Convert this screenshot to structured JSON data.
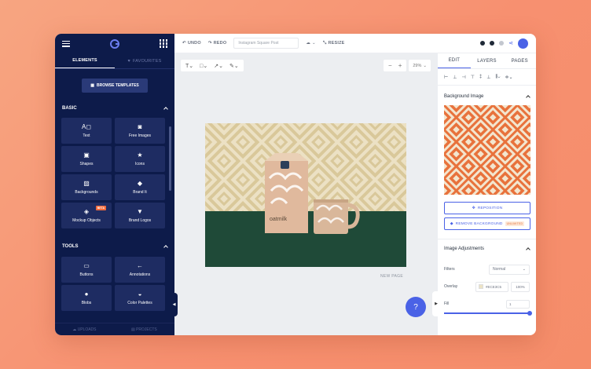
{
  "sidebar": {
    "tabs": {
      "elements": "ELEMENTS",
      "favourites": "FAVOURITES"
    },
    "browse_templates": "BROWSE TEMPLATES",
    "basic_title": "BASIC",
    "basic_items": [
      {
        "label": "Text",
        "icon": "text-icon"
      },
      {
        "label": "Free Images",
        "icon": "camera-icon"
      },
      {
        "label": "Shapes",
        "icon": "shapes-icon"
      },
      {
        "label": "Icons",
        "icon": "star-icon"
      },
      {
        "label": "Backgrounds",
        "icon": "pattern-icon"
      },
      {
        "label": "Brand It",
        "icon": "tag-icon"
      },
      {
        "label": "Mockup Objects",
        "icon": "cube-icon",
        "badge": "BETA"
      },
      {
        "label": "Brand Logos",
        "icon": "diamond-icon"
      }
    ],
    "tools_title": "TOOLS",
    "tools_items": [
      {
        "label": "Buttons",
        "icon": "cursor-icon"
      },
      {
        "label": "Annotations",
        "icon": "arrow-icon"
      },
      {
        "label": "Blobs",
        "icon": "blob-icon"
      },
      {
        "label": "Color Palettes",
        "icon": "palette-icon"
      }
    ],
    "bottom": {
      "uploads": "UPLOADS",
      "projects": "PROJECTS"
    }
  },
  "topbar": {
    "undo": "UNDO",
    "redo": "REDO",
    "doc_name_placeholder": "Instagram Square Post",
    "resize": "RESIZE"
  },
  "canvas": {
    "zoom": "29%",
    "new_page": "NEW PAGE",
    "help": "?",
    "product_label": "oatmilk"
  },
  "right_panel": {
    "tabs": [
      "EDIT",
      "LAYERS",
      "PAGES"
    ],
    "background_image_title": "Background Image",
    "reposition": "REPOSITION",
    "remove_background": "REMOVE BACKGROUND",
    "unlimited_badge": "UNLIMITED",
    "image_adjustments_title": "Image Adjustments",
    "filters_label": "Filters",
    "filters_value": "Normal",
    "overlay_label": "Overlay",
    "overlay_color": "#ECE3C5",
    "overlay_opacity": "100%",
    "fill_label": "Fill",
    "fill_value": "1"
  },
  "colors": {
    "sidebar_bg": "#0D1B4A",
    "accent": "#4A62E6",
    "pattern_orange": "#E8723C",
    "pattern_cream": "#E9DDB8",
    "table_green": "#1F4A38"
  }
}
